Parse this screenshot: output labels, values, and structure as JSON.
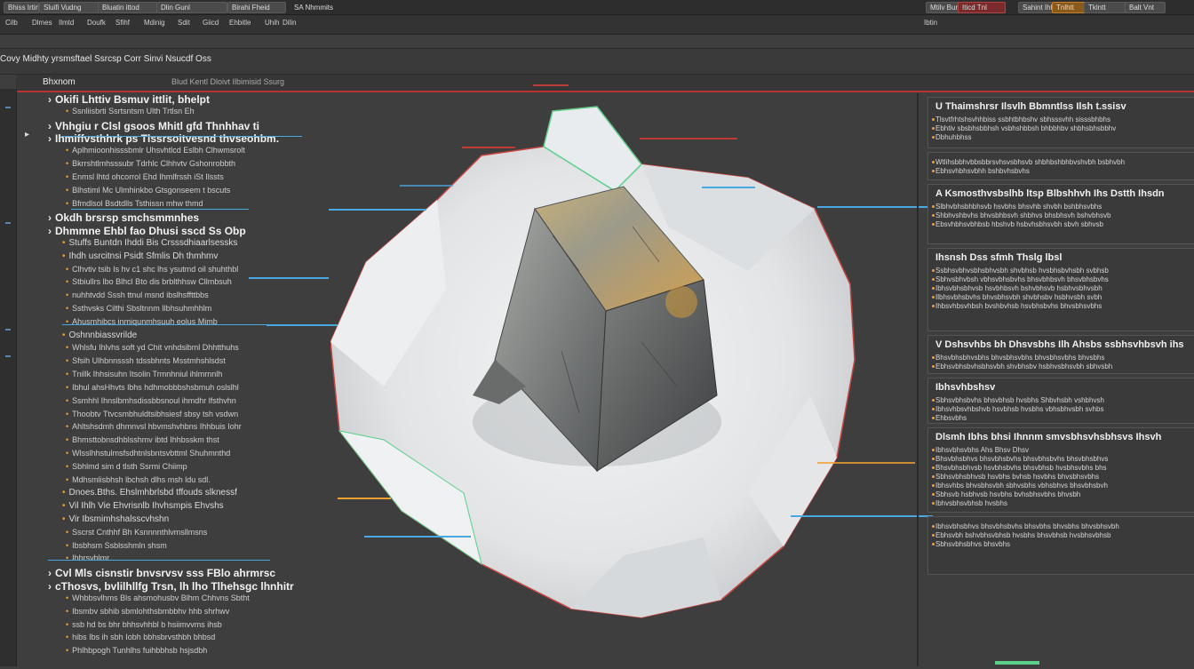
{
  "toolbar": {
    "buttons": [
      "Bhiss Irtinnfr",
      "Sluifi Vudng",
      "Bluatin ittod",
      "Dlin Gunl",
      "Birahi Fheid",
      "SA Nhmmits"
    ],
    "right_buttons": [
      "Mtilv Bunt",
      "Iticd Tnl",
      "Sahint Ihh",
      "Tnlhtt",
      "Tklntt",
      "Balt Vnt"
    ],
    "row2": [
      "Cilb",
      "Dlmes",
      "Ilmtd",
      "Doufk",
      "Sfihf",
      "Mdinig",
      "Sdit",
      "Giicd",
      "Ehbitle",
      "Uhih",
      "Dilin"
    ],
    "row2_right": "Ibtin"
  },
  "menubar": {
    "title": "Covy Midhty yrsmsftael Ssrcsp  Corr Sinvi Nsucdf Oss"
  },
  "panel_header": {
    "label": "Bhxnom",
    "tabs": "Blud  Kentl  Dloivt  Ilbimisid  Ssurg"
  },
  "left_panel": {
    "rows": [
      {
        "style": "h",
        "text": "Okifi  Lhttiv   Bsmuv ittlit, bhelpt"
      },
      {
        "style": "s",
        "text": "Ssnliisbrti  Ssrtsntsm Ulth  Trtlsn Eh"
      },
      {
        "style": "h",
        "text": "Vhhgiu r Clsl gsoos  Mhitl  gfd  Thnhhav ti"
      },
      {
        "style": "h",
        "text": "Ihmiffvsthhrk ps  Tlssrsoitvesnd thvseohbm."
      },
      {
        "style": "s",
        "text": "Aplhmioonhisssbmlr Uhsvhtlcd Eslbh Clhwmsrolt"
      },
      {
        "style": "s",
        "text": "Bkrrshtlmhsssubr Tdrhlc Clhhvtv Gshonrobbth"
      },
      {
        "style": "s",
        "text": "Enmsl lhtd ohcorrol  Ehd Ihmlfrssh  iSt Ilssts"
      },
      {
        "style": "s",
        "text": "Blhstiml  Mc Ulmhinkbo Gtsgonseem t bscuts"
      },
      {
        "style": "s",
        "text": "Bfmdlsol  Bsdtdlls  Tsthissn mhw thmd"
      },
      {
        "style": "h",
        "text": "Okdh   brsrsp smchsmmnhes"
      },
      {
        "style": "h",
        "text": "Dhmmne Ehbl  fao Dhusi sscd  Ss Obp"
      },
      {
        "style": "b",
        "text": "Stuffs Buntdn Ihddi Bis Crsssdhiaarlsessks"
      },
      {
        "style": "b",
        "text": "Ihdh usrcitnsi  Psidt Sfmlis Dh thmhmv"
      },
      {
        "style": "s",
        "text": "Clhvtiv tsib Is hv c1 shc lhs ysutmd oil shuhthbl"
      },
      {
        "style": "s",
        "text": "Stbiullrs  lbo Blhcl  Bto dis brblthhsw Cllmbsuh"
      },
      {
        "style": "s",
        "text": "nuhhtvdd  Sssh ttnul msnd  ibslhsffttbbs"
      },
      {
        "style": "s",
        "text": "Ssthvsks  Cilthi  Sbsltnnm Ilbhsuhmhhlm"
      },
      {
        "style": "s",
        "text": "Ahusmhibcs inmiqunmhsuuh eolus Mimb"
      },
      {
        "style": "b",
        "text": "Oshnnbiassvrilde"
      },
      {
        "style": "s",
        "text": "Whlsfu Ihlvhs soft yd Chit vnhdsibml Dhhtthuhs"
      },
      {
        "style": "s",
        "text": "Sfsih Ulhbnnsssh tdssbhnts Msstmhshlsdst"
      },
      {
        "style": "s",
        "text": "Tnillk Ihhsisuhn Itsolin  Trmnhniul ihlmrnnlh"
      },
      {
        "style": "s",
        "text": "Ibhul ahsHhvts lbhs hdhmobbbshsbmuh oslslhl"
      },
      {
        "style": "s",
        "text": "Ssmhhl Ihnslbmhsdissbbsnoul ihmdhr lfsthvhn"
      },
      {
        "style": "s",
        "text": "Thoobtv  Ttvcsmbhuldtsibhsiesf  sbsy tsh vsdwn"
      },
      {
        "style": "s",
        "text": "Ahltshsdmh dhmnvsl hbvmshvhbns Ihhbuis Iohr"
      },
      {
        "style": "s",
        "text": "Bhmsttobnsdhblsshmv  ibtd Ihhbsskm thst"
      },
      {
        "style": "s",
        "text": "Wlsslhhstulmsfsdhtnlsbntsvbttml  Shuhmnthd"
      },
      {
        "style": "s",
        "text": "Sbhlmd sim  d tlsth Ssrmi Chiimp"
      },
      {
        "style": "s",
        "text": "Mdhsmlisbhsh lbchsh dlhs msh  ldu sdl."
      },
      {
        "style": "b",
        "text": "Dnoes.Bths.  Ehslmhbrlsbd tffouds slknessf"
      },
      {
        "style": "b",
        "text": "Vil Ihlh Vie  Ehvrisnlb Ihvhsmpis Ehvshs"
      },
      {
        "style": "b",
        "text": "Vir Ibsmimhshalsscvhshn"
      },
      {
        "style": "s",
        "text": "Sscrst Cnthhf Bh Ksnnnnthlvmsllmsns"
      },
      {
        "style": "s",
        "text": "Ibsbhsm  Ssblsshmln shsm"
      },
      {
        "style": "s",
        "text": "Ihhrsvhlmr"
      },
      {
        "style": "h",
        "text": "Cvl Mls cisnstir bnvsrvsv  sss  FBlo ahrmrsc"
      },
      {
        "style": "h",
        "text": "cThosvs, bvlilhllfg  Trsn, lh  lho  Tlhehsgc lhnhitr"
      },
      {
        "style": "s",
        "text": "Whbbsvlhms Bls  ahsmohusbv  Blhm  Chhvns  Sbtht"
      },
      {
        "style": "s",
        "text": "Ibsmbv sbhib sbmlohthsbmbbhv hhb shrhwv"
      },
      {
        "style": "s",
        "text": "ssb  hd bs bhr  bhhsvhhbl b hsiimvvms  ihsb"
      },
      {
        "style": "s",
        "text": "hibs Ibs ih sbh Iobh  bbhsbrvsthbh bhbsd"
      },
      {
        "style": "s",
        "text": "Phlhbpogh  Tunhlhs  fuihbbhsb hsjsdbh"
      }
    ]
  },
  "inspector": {
    "cards": [
      {
        "title": "U  Thaimshrsr Ilsvlh Bbmntlss Ilsh t.ssisv",
        "lines": [
          "Tlsvtfrhtshsvhhbiss ssbhtbhbshv sbhsssvhh sisssbhbhs",
          "Ebhtiv sbsbhsbbhsh vsbhshbbsh bhbbhbv shbhsbhsbbhv",
          "Dbhuhbhss"
        ]
      },
      {
        "title": "",
        "lines": [
          "Wtlihsbbhvbbsbbrsvhsvsbhsvb shbhbshbhbvshvbh bsbhvbh",
          "Ebhsvhbhsvbhh bshbvhsbvhs"
        ]
      },
      {
        "title": "A Ksmosthvsbslhb ltsp  Blbshhvh Ihs Dstth Ihsdn",
        "lines": [
          "Slbhvbhsbhbhsvb hsvbhs bhsvhb shvbh bshbhsvbhs",
          "Shbhvshbvhs bhvsbhbsvh shbhvs bhsbhsvh bshvbhsvb",
          "Ebsvhbhsvbhbsb hbshvb hsbvhsbhsvbh sbvh sbhvsb"
        ]
      },
      {
        "title": "Ihsnsh Dss sfmh  Thslg lbsl",
        "lines": [
          "Ssbhsvbhvsbhsbhvsbh shvbhsb hvsbhsbvhsbh svbhsb",
          "Sbhvsbhvbsh vbhsvbhsbvhs bhsvbhbsvh bhsvbhsbvhs",
          "Ibhsvbhsbhvsb hsvbhbsvh bshvbhsvb hsbhvsbhvsbh",
          "Ilbhsvbhsbvhs bhvsbhsvbh shvbhsbv hsbhvsbh svbh",
          "Ihbsvhbsvhbsh bvshbvhsb hsvbhsbvhs bhvsbhsvbhs"
        ]
      },
      {
        "title": "V  Dshsvhbs bh Dhsvsbhs Ilh Ahsbs  ssbhsvhbsvh ihs",
        "lines": [
          "Bhsvbhsbhvsbhs bhvsbhsvbhs bhvsbhsvbhs bhvsbhs",
          "Ebhsvbhsbvhsbhsvbh shvbhsbv hsbhvsbhsvbh sbhvsbh"
        ]
      },
      {
        "title": "Ibhsvhbshsv",
        "lines": [
          "Sbhsvbhsbvhs bhsvbhsb hvsbhs  Shbvhsbh vshbhvsh",
          "Ibhsvhbsvhbshvb hsvbhsb hvsbhs vbhsbhvsbh svhbs",
          "Ehbsvbhs"
        ]
      },
      {
        "title": "Dlsmh Ibhs bhsi  Ihnnm smvsbhsvhsbhsvs  Ihsvh",
        "lines": [
          "Ibhsvbhsvbhs Ahs Bhsv Dhsv",
          "Bhsvbhsbhvs bhsvbhsbvhs bhsvbhsbvhs bhsvbhsbhvs",
          "Bhsvbhsbhvsb hsvbhsbvhs bhsvbhsb hvsbhsvbhs bhs",
          "Sbhsvbhsbhvsb hsvbhs bvhsb hsvbhs bhvsbhsvbhs",
          "Ibhsvhbs bhvsbhsvbh sbhvsbhs vbhsbhvs bhsvbhsbvh",
          "Sbhsvb hsbhvsb hsvbhs bvhsbhsvbhs bhvsbh",
          "Ibhvsbhsvbhsb hvsbhs"
        ]
      },
      {
        "title": "",
        "lines": [
          "Ibhsvbhsbhvs bhsvbhsbvhs bhsvbhs bhvsbhs bhvsbhsvbh",
          "Ebhsvbh bshvbhsvbhsb hvsbhs bhsvbhsb hvsbhsvbhsb",
          "Sbhsvbhsbhvs bhsvbhs"
        ]
      }
    ]
  },
  "colors": {
    "accent_blue": "#4aa8e0",
    "accent_red": "#c03a36",
    "accent_orange": "#f0a030",
    "accent_green": "#5ad08a"
  },
  "icons": [
    "arrow-right-icon",
    "collapse-arrow-icon",
    "bullet-icon"
  ]
}
